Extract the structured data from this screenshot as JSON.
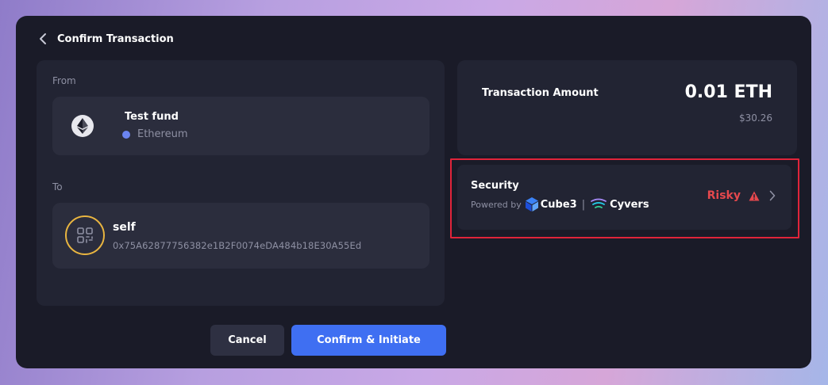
{
  "header": {
    "title": "Confirm Transaction"
  },
  "from": {
    "section_label": "From",
    "account_name": "Test fund",
    "network": "Ethereum"
  },
  "to": {
    "section_label": "To",
    "name": "self",
    "address": "0x75A62877756382e1B2F0074eDA484b18E30A55Ed"
  },
  "amount": {
    "label": "Transaction Amount",
    "value": "0.01 ETH",
    "fiat": "$30.26"
  },
  "security": {
    "title": "Security",
    "powered_by": "Powered by",
    "provider_1": "Cube3",
    "separator": "|",
    "provider_2": "Cyvers",
    "status": "Risky"
  },
  "buttons": {
    "cancel": "Cancel",
    "confirm": "Confirm & Initiate"
  },
  "colors": {
    "modal_bg": "#1a1b28",
    "panel_bg": "#222433",
    "card_bg": "#2b2d3d",
    "accent": "#3f6ff2",
    "risk": "#e5484d",
    "highlight": "#e0243a",
    "avatar_ring": "#e9b540",
    "network_dot": "#6b84f0"
  },
  "icons": [
    "back-icon",
    "ethereum-logo-icon",
    "network-dot-icon",
    "qr-code-icon",
    "cube3-logo-icon",
    "cyvers-logo-icon",
    "warning-icon",
    "chevron-right-icon"
  ]
}
